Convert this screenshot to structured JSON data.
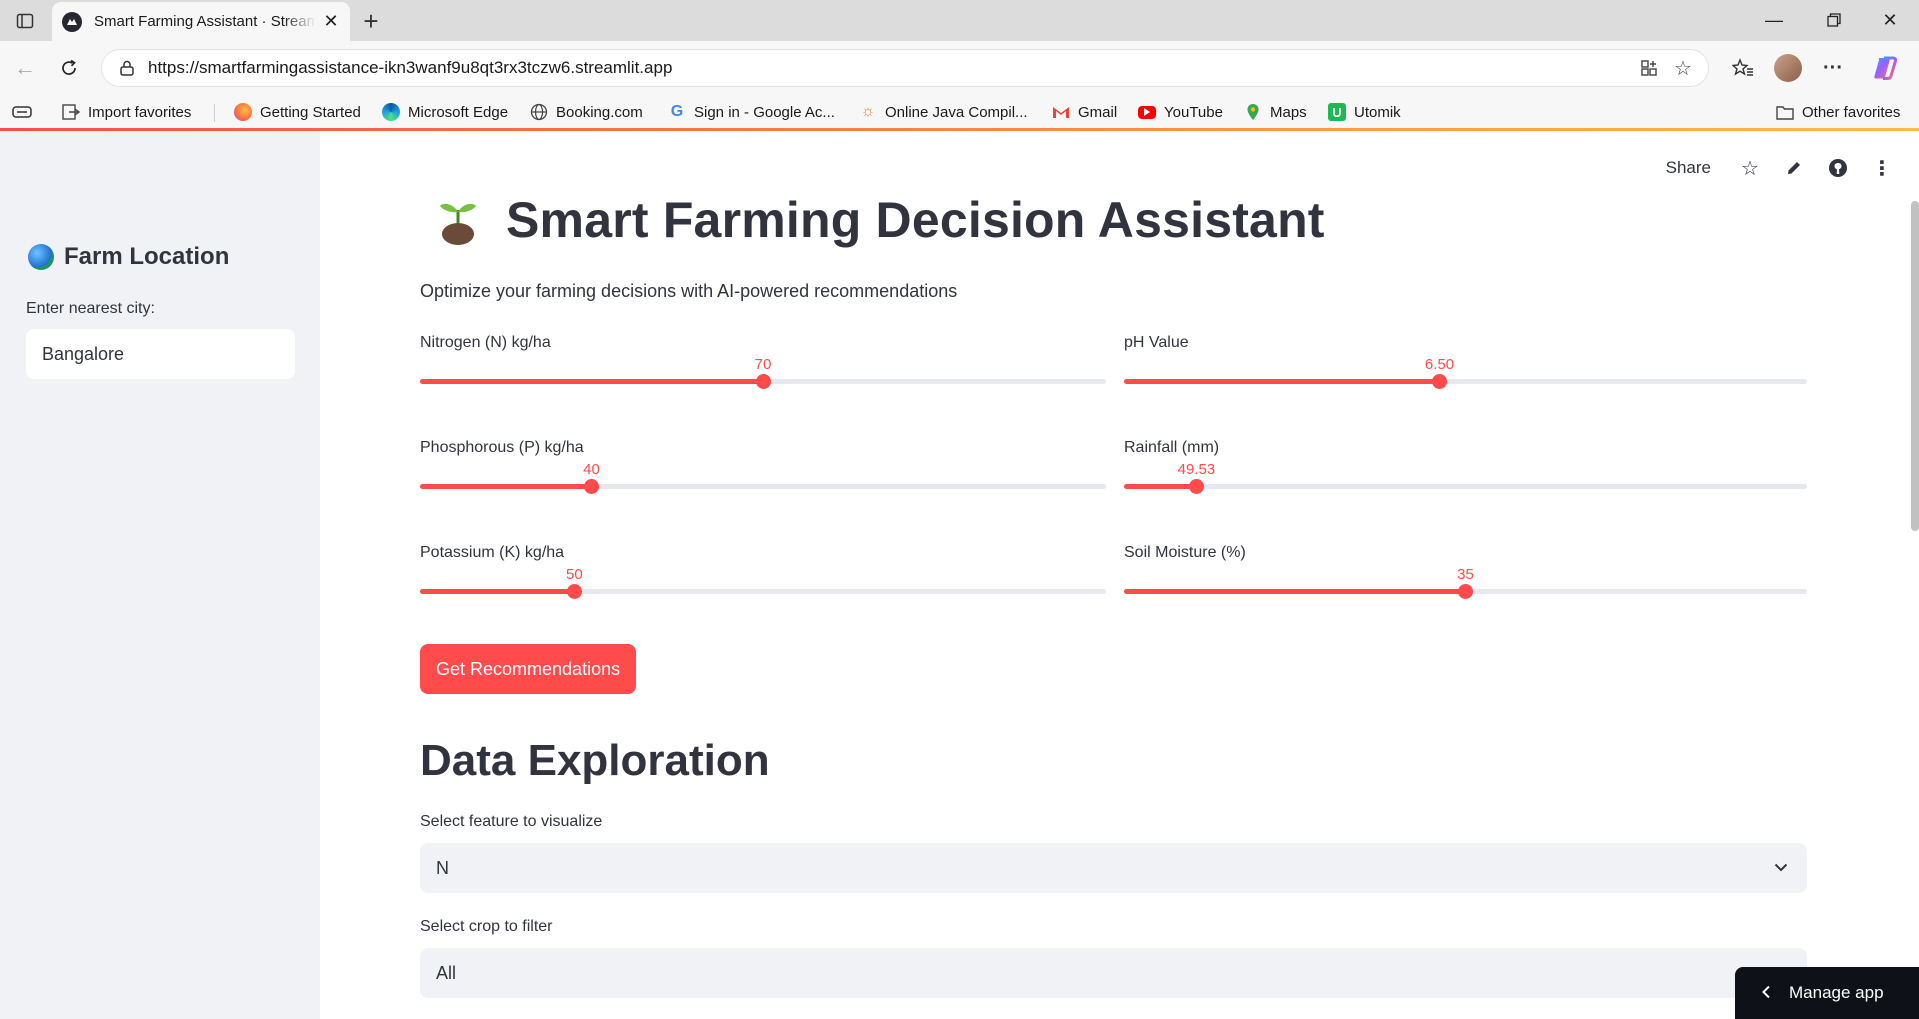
{
  "browser": {
    "tab_title": "Smart Farming Assistant · Streamlit",
    "url": "https://smartfarmingassistance-ikn3wanf9u8qt3rx3tczw6.streamlit.app",
    "bookmarks": [
      {
        "label": "Import favorites",
        "icon": "import-icon"
      },
      {
        "label": "Getting Started",
        "icon": "firefox-icon"
      },
      {
        "label": "Microsoft Edge",
        "icon": "edge-icon"
      },
      {
        "label": "Booking.com",
        "icon": "globe-icon"
      },
      {
        "label": "Sign in - Google Ac...",
        "icon": "google-icon"
      },
      {
        "label": "Online Java Compil...",
        "icon": "sun-icon"
      },
      {
        "label": "Gmail",
        "icon": "gmail-icon"
      },
      {
        "label": "YouTube",
        "icon": "youtube-icon"
      },
      {
        "label": "Maps",
        "icon": "maps-icon"
      },
      {
        "label": "Utomik",
        "icon": "utomik-icon"
      }
    ],
    "other_favorites": "Other favorites"
  },
  "sidebar": {
    "title": "Farm Location",
    "city_label": "Enter nearest city:",
    "city_value": "Bangalore"
  },
  "header": {
    "share": "Share"
  },
  "main": {
    "title": "Smart Farming Decision Assistant",
    "subtitle": "Optimize your farming decisions with AI-powered recommendations",
    "sliders": [
      {
        "label": "Nitrogen (N) kg/ha",
        "value": "70",
        "fraction": 0.5
      },
      {
        "label": "pH Value",
        "value": "6.50",
        "fraction": 0.462
      },
      {
        "label": "Phosphorous (P) kg/ha",
        "value": "40",
        "fraction": 0.25
      },
      {
        "label": "Rainfall (mm)",
        "value": "49.53",
        "fraction": 0.106
      },
      {
        "label": "Potassium (K) kg/ha",
        "value": "50",
        "fraction": 0.225
      },
      {
        "label": "Soil Moisture (%)",
        "value": "35",
        "fraction": 0.5
      }
    ],
    "button": "Get Recommendations",
    "section_title": "Data Exploration",
    "feature_label": "Select feature to visualize",
    "feature_value": "N",
    "crop_label": "Select crop to filter",
    "crop_value": "All"
  },
  "manage_app": "Manage app",
  "colors": {
    "accent": "#ff4b4b",
    "sidebar_bg": "#f0f2f6",
    "text": "#31333f"
  }
}
